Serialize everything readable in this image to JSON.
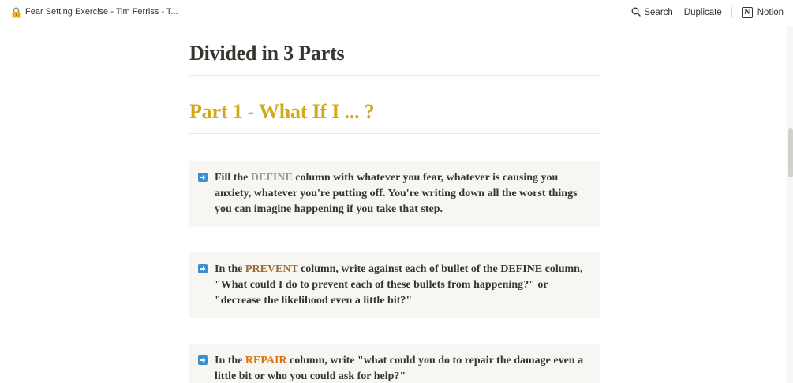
{
  "window": {
    "doc_title": "Fear Setting Exercise - Tim Ferriss - T...",
    "page_icon": "lock-icon"
  },
  "topbar": {
    "search_label": "Search",
    "duplicate_label": "Duplicate",
    "notion_label": "Notion",
    "notion_logo_letter": "N"
  },
  "content": {
    "heading": "Divided in 3 Parts",
    "subheading": "Part 1 - What If I ... ?",
    "subheading_color": "#d3a91c",
    "callouts": [
      {
        "icon": "arrow-right-icon",
        "pre": "Fill the ",
        "keyword": "DEFINE",
        "post": " column with whatever you fear, whatever is causing you anxiety, whatever you're putting off. You're writing down all the worst things you can imagine happening if you take that step."
      },
      {
        "icon": "arrow-right-icon",
        "pre": "In the ",
        "keyword": "PREVENT",
        "post": " column, write against each of bullet of the DEFINE column, \"What could I do to prevent each of these bullets from happening?\" or \"decrease the likelihood even a little bit?\""
      },
      {
        "icon": "arrow-right-icon",
        "pre": "In the ",
        "keyword": "REPAIR",
        "post": " column, write \"what could you do to repair the damage even a little bit or who you could ask for help?\""
      }
    ]
  },
  "colors": {
    "keyword_define": "#9b9a97",
    "keyword_prevent": "#9f6b31",
    "keyword_repair": "#d9730d",
    "callout_bg": "#f7f6f3",
    "arrow_icon_bg": "#3d8ed1"
  }
}
